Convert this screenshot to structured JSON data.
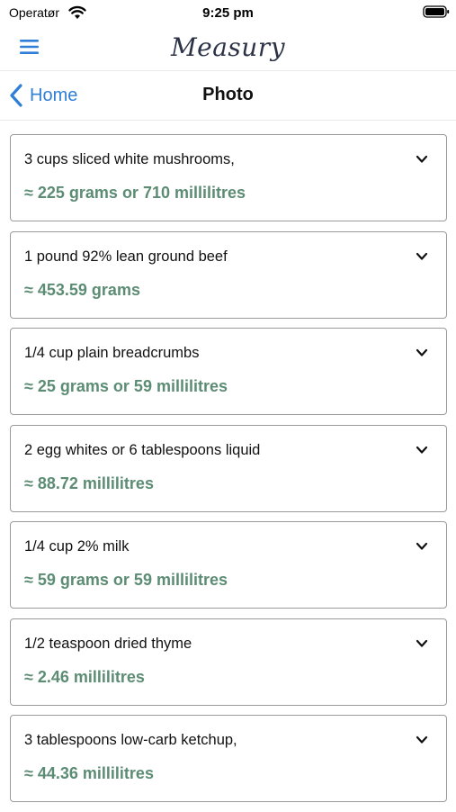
{
  "status_bar": {
    "carrier": "Operatør",
    "time": "9:25 pm"
  },
  "header": {
    "brand_title": "Measury"
  },
  "nav": {
    "back_label": "Home",
    "title": "Photo"
  },
  "colors": {
    "accent_blue": "#2f7fd6",
    "conversion_green": "#5c8c74",
    "brand_text": "#2d3347",
    "card_border": "#9a9a9a"
  },
  "icons": {
    "menu": "hamburger-menu-icon",
    "back": "chevron-left-icon",
    "expand": "chevron-down-icon",
    "wifi": "wifi-icon",
    "battery": "battery-icon"
  },
  "ingredients": [
    {
      "text": "3 cups sliced white mushrooms,",
      "conversion": "≈ 225 grams or 710 millilitres"
    },
    {
      "text": "1 pound 92% lean ground beef",
      "conversion": "≈ 453.59 grams"
    },
    {
      "text": "1/4 cup plain breadcrumbs",
      "conversion": "≈ 25 grams or 59 millilitres"
    },
    {
      "text": "2 egg whites or 6 tablespoons liquid",
      "conversion": "≈ 88.72 millilitres"
    },
    {
      "text": "1/4 cup 2% milk",
      "conversion": "≈ 59 grams or 59 millilitres"
    },
    {
      "text": "1/2 teaspoon dried thyme",
      "conversion": "≈ 2.46 millilitres"
    },
    {
      "text": "3 tablespoons low-carb ketchup,",
      "conversion": "≈ 44.36 millilitres"
    }
  ]
}
